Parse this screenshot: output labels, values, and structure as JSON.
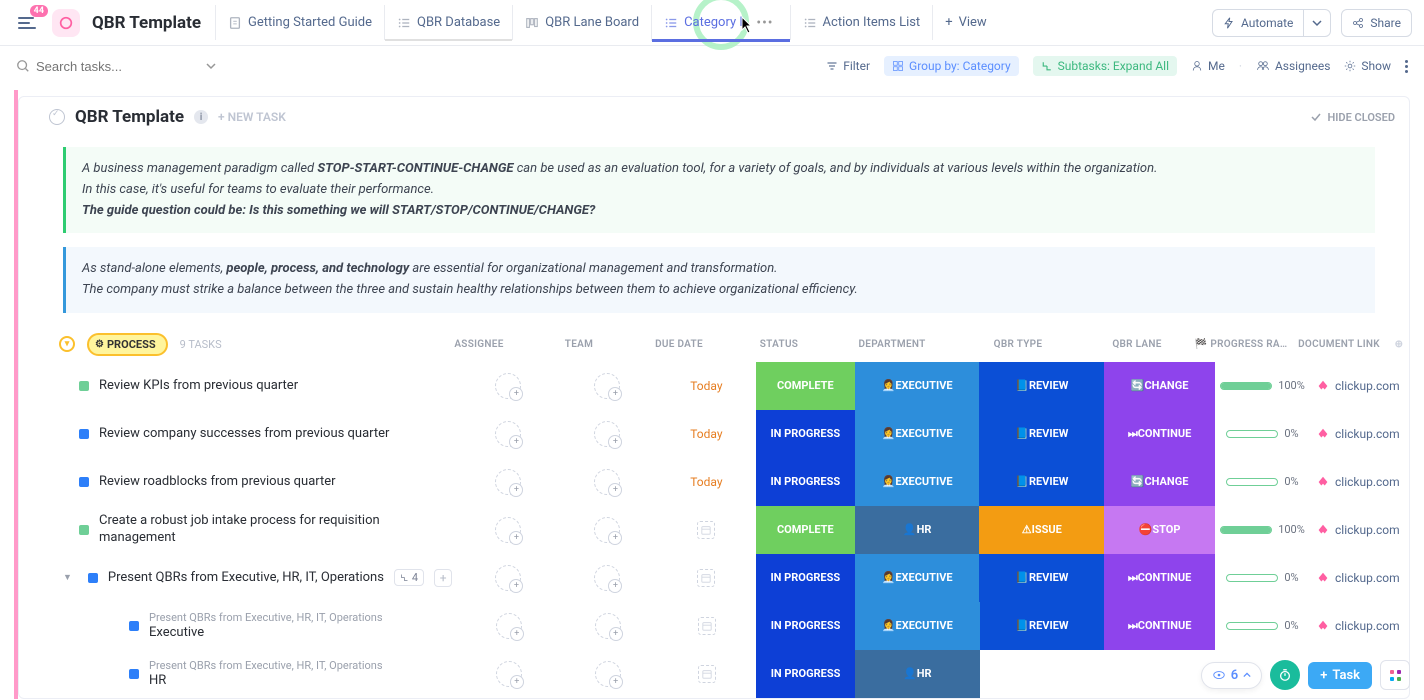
{
  "app": {
    "badge": "44",
    "title": "QBR Template"
  },
  "views": [
    {
      "icon": "doc",
      "label": "Getting Started Guide",
      "active": false
    },
    {
      "icon": "list",
      "label": "QBR Database",
      "active": false,
      "underline": "gray"
    },
    {
      "icon": "board",
      "label": "QBR Lane Board",
      "active": false
    },
    {
      "icon": "list",
      "label": "Category L",
      "active": true,
      "underline": "blue"
    },
    {
      "icon": "list",
      "label": "Action Items List",
      "active": false
    }
  ],
  "view_add": "View",
  "topright": {
    "automate": "Automate",
    "share": "Share"
  },
  "toolbar": {
    "search_placeholder": "Search tasks...",
    "filter": "Filter",
    "groupby": "Group by: Category",
    "subtasks": "Subtasks: Expand All",
    "me": "Me",
    "assignees": "Assignees",
    "show": "Show"
  },
  "list": {
    "title": "QBR Template",
    "new_task": "+ NEW TASK",
    "hide_closed": "HIDE CLOSED",
    "desc1_pre": "A business management paradigm called ",
    "desc1_bold": "STOP-START-CONTINUE-CHANGE",
    "desc1_post": " can be used as an evaluation tool, for a variety of goals, and by individuals at various levels within the organization.",
    "desc1_line2": "In this case, it's useful for teams to evaluate their performance.",
    "desc1_line3": "The guide question could be: Is this something we will START/STOP/CONTINUE/CHANGE?",
    "desc2_pre": "As stand-alone elements, ",
    "desc2_bold": "people, process, and technology",
    "desc2_post": " are essential for organizational management and transformation.",
    "desc2_line2": "The company must strike a balance between the three and sustain healthy relationships between them to achieve organizational efficiency."
  },
  "group": {
    "name": "PROCESS",
    "count": "9 TASKS"
  },
  "columns": {
    "assignee": "ASSIGNEE",
    "team": "TEAM",
    "due": "DUE DATE",
    "status": "STATUS",
    "dept": "DEPARTMENT",
    "qtype": "QBR TYPE",
    "lane": "QBR LANE",
    "prog": "PROGRESS RA…",
    "doc": "DOCUMENT LINK"
  },
  "rows": [
    {
      "sq": "green",
      "title": "Review KPIs from previous quarter",
      "due": "Today",
      "status": "COMPLETE",
      "status_bg": "complete",
      "dept": "👩‍💼EXECUTIVE",
      "dept_bg": "exec",
      "qtype": "📘REVIEW",
      "qtype_bg": "review",
      "lane": "🔄CHANGE",
      "lane_bg": "change",
      "prog": 100,
      "doc": "clickup.com"
    },
    {
      "sq": "blue",
      "title": "Review company successes from previous quarter",
      "due": "Today",
      "status": "IN PROGRESS",
      "status_bg": "inprogress",
      "dept": "👩‍💼EXECUTIVE",
      "dept_bg": "exec",
      "qtype": "📘REVIEW",
      "qtype_bg": "review",
      "lane": "⏭CONTINUE",
      "lane_bg": "continue",
      "prog": 0,
      "doc": "clickup.com"
    },
    {
      "sq": "blue",
      "title": "Review roadblocks from previous quarter",
      "due": "Today",
      "status": "IN PROGRESS",
      "status_bg": "inprogress",
      "dept": "👩‍💼EXECUTIVE",
      "dept_bg": "exec",
      "qtype": "📘REVIEW",
      "qtype_bg": "review",
      "lane": "🔄CHANGE",
      "lane_bg": "change",
      "prog": 0,
      "doc": "clickup.com"
    },
    {
      "sq": "green",
      "title": "Create a robust job intake process for requisition management",
      "due": "",
      "status": "COMPLETE",
      "status_bg": "complete",
      "dept": "👤HR",
      "dept_bg": "hr",
      "qtype": "⚠ISSUE",
      "qtype_bg": "issue",
      "lane": "⛔STOP",
      "lane_bg": "stop",
      "prog": 100,
      "doc": "clickup.com"
    },
    {
      "sq": "blue",
      "title": "Present QBRs from Executive, HR, IT, Operations",
      "due": "",
      "status": "IN PROGRESS",
      "status_bg": "inprogress",
      "dept": "👩‍💼EXECUTIVE",
      "dept_bg": "exec",
      "qtype": "📘REVIEW",
      "qtype_bg": "review",
      "lane": "⏭CONTINUE",
      "lane_bg": "continue",
      "prog": 0,
      "doc": "clickup.com",
      "expand": true,
      "subcount": "4"
    }
  ],
  "subtasks": [
    {
      "parent": "Present QBRs from Executive, HR, IT, Operations",
      "title": "Executive",
      "status": "IN PROGRESS",
      "status_bg": "inprogress",
      "dept": "👩‍💼EXECUTIVE",
      "dept_bg": "exec",
      "qtype": "📘REVIEW",
      "qtype_bg": "review",
      "lane": "⏭CONTINUE",
      "lane_bg": "continue",
      "prog": 0,
      "doc": "clickup.com"
    },
    {
      "parent": "Present QBRs from Executive, HR, IT, Operations",
      "title": "HR",
      "status": "IN PROGRESS",
      "status_bg": "inprogress",
      "dept": "👤HR",
      "dept_bg": "hr",
      "qtype": "",
      "qtype_bg": "",
      "lane": "",
      "lane_bg": "",
      "prog": null,
      "doc": ""
    }
  ],
  "bottom": {
    "watching": "6",
    "task_btn": "Task"
  }
}
